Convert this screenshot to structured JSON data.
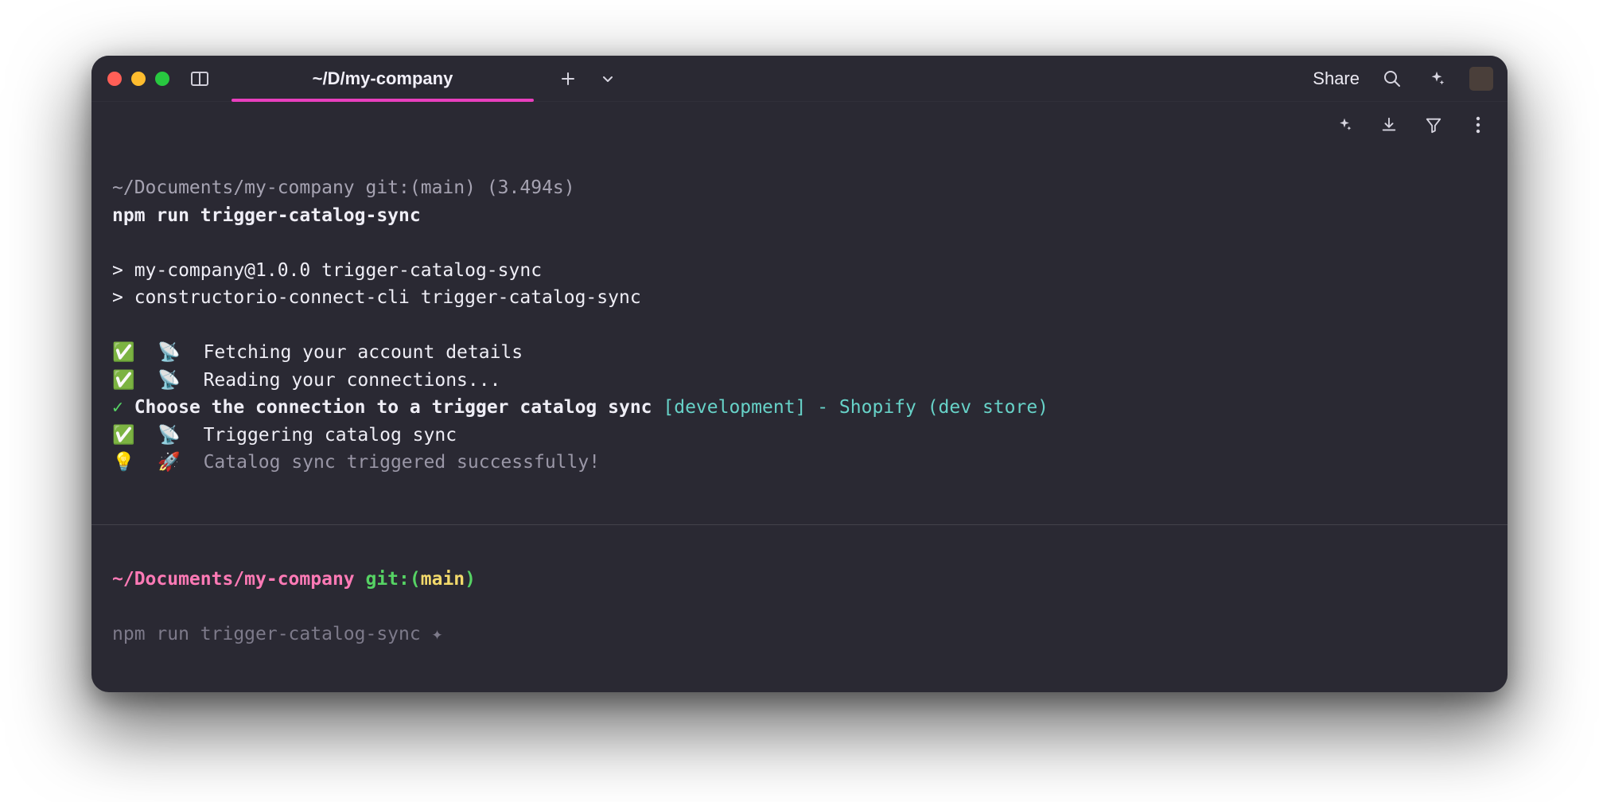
{
  "titlebar": {
    "tab_title": "~/D/my-company",
    "share_label": "Share"
  },
  "block1": {
    "prompt_path": "~/Documents/my-company",
    "git_prefix": " git:(",
    "git_branch": "main",
    "git_suffix": ")",
    "timing": " (3.494s)",
    "command": "npm run trigger-catalog-sync",
    "out_line1": "> my-company@1.0.0 trigger-catalog-sync",
    "out_line2": "> constructorio-connect-cli trigger-catalog-sync",
    "step1_icons": "✅ 📡 ",
    "step1_text": "Fetching your account details",
    "step2_icons": "✅ 📡 ",
    "step2_text": "Reading your connections...",
    "choose_check": "✓ ",
    "choose_label": "Choose the connection to a trigger catalog sync ",
    "choose_value": "[development] - Shopify (dev store)",
    "step3_icons": "✅ 📡 ",
    "step3_text": "Triggering catalog sync",
    "done_icons": "💡 🚀 ",
    "done_text": "Catalog sync triggered successfully!"
  },
  "block2": {
    "prompt_path": "~/Documents/my-company",
    "git_label": " git:",
    "paren_open": "(",
    "git_branch": "main",
    "paren_close": ")",
    "suggestion": "npm run trigger-catalog-sync ",
    "suggestion_icon": "✦"
  }
}
